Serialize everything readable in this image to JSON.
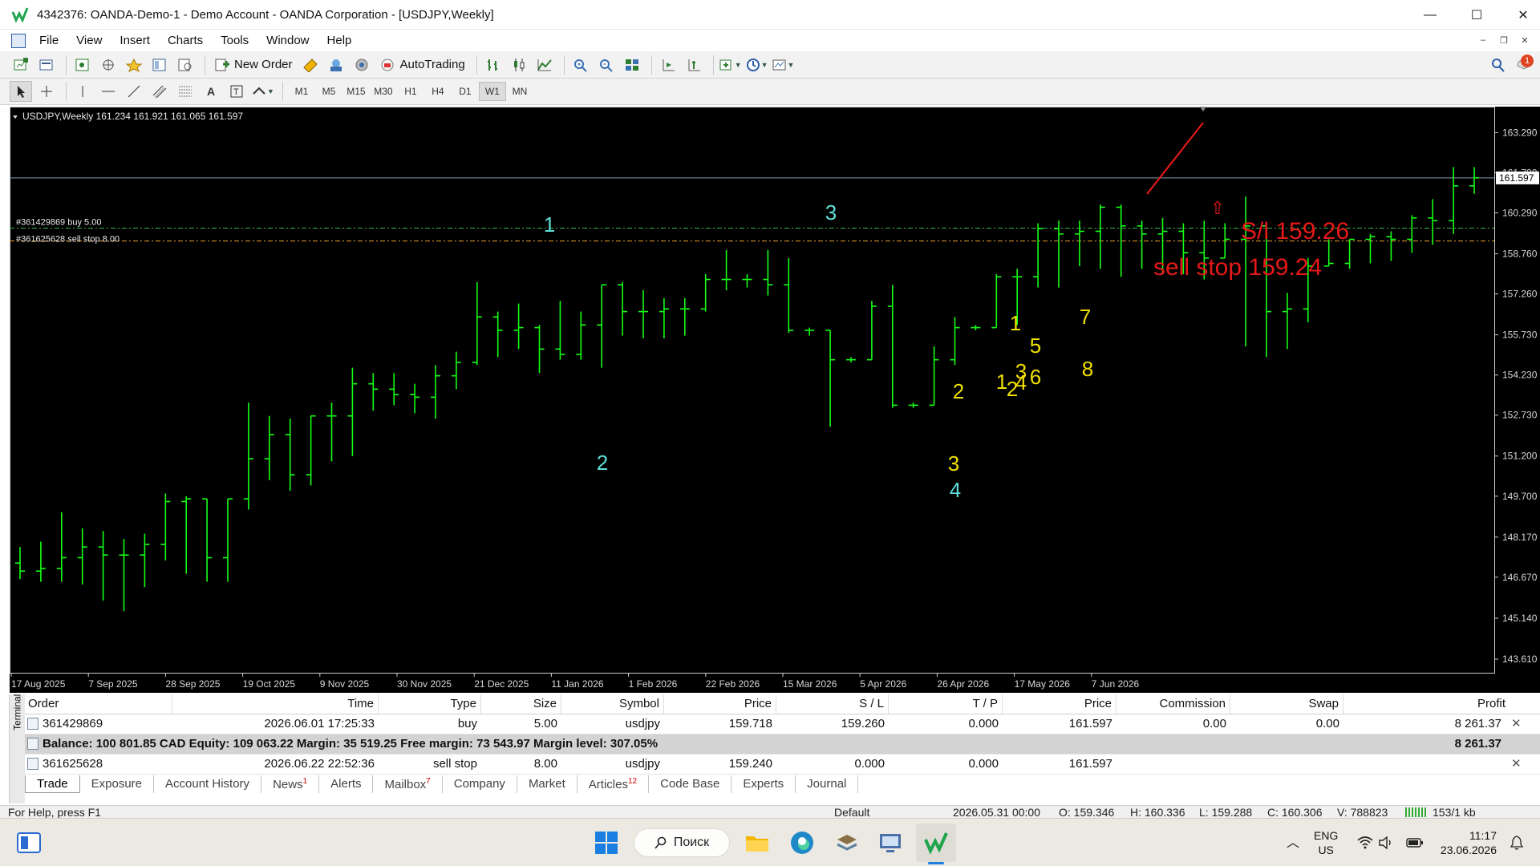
{
  "window": {
    "title": "4342376: OANDA-Demo-1 - Demo Account - OANDA Corporation - [USDJPY,Weekly]",
    "minimize": "—",
    "maximize": "☐",
    "close": "✕"
  },
  "menu": [
    "File",
    "View",
    "Insert",
    "Charts",
    "Tools",
    "Window",
    "Help"
  ],
  "toolbar": {
    "new_order": "New Order",
    "autotrading": "AutoTrading",
    "timeframes": [
      "M1",
      "M5",
      "M15",
      "M30",
      "H1",
      "H4",
      "D1",
      "W1",
      "MN"
    ],
    "active_timeframe": "W1",
    "notification_count": "1"
  },
  "chart": {
    "header": "USDJPY,Weekly  161.234 161.921 161.065 161.597",
    "current_price_label": "161.597",
    "order_line_buy": "#361429869 buy 5.00",
    "order_line_sell": "#361625628 sell stop 8.00",
    "annotation_sl": "S/l 159.26",
    "annotation_sell_stop": "sell stop 159.24",
    "arrow_up": "⇧"
  },
  "chart_data": {
    "type": "ohlc",
    "symbol": "USDJPY",
    "timeframe": "Weekly",
    "ylim": [
      143.1,
      164.2
    ],
    "y_ticks": [
      "163.290",
      "161.790",
      "160.290",
      "158.760",
      "157.260",
      "155.730",
      "154.230",
      "152.730",
      "151.200",
      "149.700",
      "148.170",
      "146.670",
      "145.140",
      "143.610"
    ],
    "x_ticks": [
      "17 Aug 2025",
      "7 Sep 2025",
      "28 Sep 2025",
      "19 Oct 2025",
      "9 Nov 2025",
      "30 Nov 2025",
      "21 Dec 2025",
      "11 Jan 2026",
      "1 Feb 2026",
      "22 Feb 2026",
      "15 Mar 2026",
      "5 Apr 2026",
      "26 Apr 2026",
      "17 May 2026",
      "7 Jun 2026"
    ],
    "last_price": 161.597,
    "buy_order_price": 159.718,
    "sell_stop_price": 159.24,
    "bars": [
      [
        147.2,
        147.8,
        146.6,
        146.9
      ],
      [
        146.9,
        148.0,
        146.5,
        147.0
      ],
      [
        147.0,
        149.1,
        146.5,
        147.4
      ],
      [
        147.4,
        148.5,
        146.4,
        147.8
      ],
      [
        147.8,
        148.4,
        145.8,
        147.5
      ],
      [
        147.5,
        148.1,
        145.4,
        147.5
      ],
      [
        147.5,
        148.3,
        146.3,
        147.9
      ],
      [
        147.9,
        149.8,
        147.3,
        149.5
      ],
      [
        149.5,
        149.7,
        146.8,
        149.6
      ],
      [
        149.6,
        149.6,
        146.5,
        147.4
      ],
      [
        147.4,
        149.6,
        146.5,
        149.6
      ],
      [
        149.6,
        153.2,
        149.2,
        151.1
      ],
      [
        151.1,
        152.7,
        150.3,
        152.0
      ],
      [
        152.0,
        152.6,
        149.9,
        150.5
      ],
      [
        150.5,
        152.7,
        150.1,
        152.7
      ],
      [
        152.7,
        153.2,
        151.0,
        152.7
      ],
      [
        152.7,
        154.5,
        151.2,
        153.9
      ],
      [
        153.9,
        154.3,
        152.9,
        153.7
      ],
      [
        153.7,
        154.3,
        153.1,
        153.5
      ],
      [
        153.5,
        153.9,
        152.8,
        153.4
      ],
      [
        153.4,
        154.6,
        152.6,
        154.2
      ],
      [
        154.2,
        155.1,
        153.7,
        154.7
      ],
      [
        154.7,
        157.7,
        154.6,
        156.4
      ],
      [
        156.4,
        156.6,
        154.9,
        155.9
      ],
      [
        155.9,
        156.9,
        155.2,
        156.0
      ],
      [
        156.0,
        156.1,
        154.3,
        155.2
      ],
      [
        155.2,
        157.0,
        154.8,
        155.0
      ],
      [
        155.0,
        156.6,
        154.8,
        156.1
      ],
      [
        156.1,
        157.6,
        154.5,
        157.6
      ],
      [
        157.6,
        157.7,
        155.7,
        156.6
      ],
      [
        156.6,
        157.4,
        155.6,
        156.6
      ],
      [
        156.6,
        157.1,
        155.6,
        156.7
      ],
      [
        156.7,
        157.1,
        155.7,
        156.7
      ],
      [
        156.7,
        158.0,
        156.6,
        157.8
      ],
      [
        157.8,
        158.9,
        157.4,
        157.8
      ],
      [
        157.8,
        158.0,
        157.5,
        157.8
      ],
      [
        157.8,
        158.9,
        157.2,
        157.6
      ],
      [
        157.6,
        158.6,
        155.8,
        155.9
      ],
      [
        155.9,
        156.0,
        155.7,
        155.9
      ],
      [
        155.9,
        155.9,
        152.3,
        154.8
      ],
      [
        154.8,
        154.9,
        154.7,
        154.8
      ],
      [
        154.8,
        157.0,
        154.8,
        156.8
      ],
      [
        156.8,
        157.6,
        153.0,
        153.1
      ],
      [
        153.1,
        153.2,
        153.0,
        153.1
      ],
      [
        153.1,
        155.3,
        153.1,
        154.8
      ],
      [
        154.8,
        156.4,
        154.6,
        156.0
      ],
      [
        156.0,
        156.1,
        155.9,
        156.0
      ],
      [
        156.0,
        158.0,
        156.0,
        157.9
      ],
      [
        157.9,
        158.2,
        156.1,
        157.9
      ],
      [
        157.9,
        159.9,
        157.5,
        159.7
      ],
      [
        159.7,
        160.0,
        157.5,
        159.5
      ],
      [
        159.5,
        160.0,
        158.3,
        159.6
      ],
      [
        159.6,
        160.6,
        158.2,
        160.5
      ],
      [
        160.5,
        160.6,
        157.9,
        159.8
      ],
      [
        159.8,
        160.0,
        158.2,
        159.5
      ],
      [
        159.5,
        160.1,
        158.0,
        159.6
      ],
      [
        159.6,
        159.9,
        158.0,
        158.8
      ],
      [
        158.8,
        160.0,
        157.8,
        158.6
      ],
      [
        158.6,
        159.9,
        158.8,
        159.3
      ],
      [
        159.3,
        160.9,
        155.3,
        159.8
      ],
      [
        159.8,
        157.3,
        154.9,
        156.6
      ],
      [
        156.6,
        157.3,
        155.2,
        156.7
      ],
      [
        156.7,
        158.6,
        156.2,
        158.3
      ],
      [
        158.3,
        159.3,
        158.5,
        158.4
      ],
      [
        158.4,
        159.2,
        158.2,
        159.3
      ],
      [
        159.3,
        159.5,
        158.4,
        159.4
      ],
      [
        159.4,
        159.6,
        158.5,
        159.3
      ],
      [
        159.3,
        160.2,
        158.8,
        160.1
      ],
      [
        160.1,
        160.8,
        159.1,
        160.0
      ],
      [
        160.0,
        162.0,
        159.5,
        161.3
      ],
      [
        161.3,
        162.0,
        161.0,
        161.6
      ]
    ]
  },
  "annotations": [
    {
      "text": "1",
      "color": "#5fe0d8"
    },
    {
      "text": "2",
      "color": "#5fe0d8"
    },
    {
      "text": "3",
      "color": "#5fe0d8"
    },
    {
      "text": "1",
      "color": "#f0e000"
    },
    {
      "text": "2",
      "color": "#f0e000"
    },
    {
      "text": "3",
      "color": "#f0e000"
    },
    {
      "text": "4",
      "color": "#5fe0d8"
    },
    {
      "text": "1",
      "color": "#f0e000"
    },
    {
      "text": "2",
      "color": "#f0e000"
    },
    {
      "text": "3",
      "color": "#f0e000"
    },
    {
      "text": "4",
      "color": "#f0e000"
    },
    {
      "text": "5",
      "color": "#f0e000"
    },
    {
      "text": "6",
      "color": "#f0e000"
    },
    {
      "text": "7",
      "color": "#f0e000"
    },
    {
      "text": "8",
      "color": "#f0e000"
    }
  ],
  "terminal": {
    "side_label": "Terminal",
    "columns": [
      "Order",
      "Time",
      "Type",
      "Size",
      "Symbol",
      "Price",
      "S / L",
      "T / P",
      "Price",
      "Commission",
      "Swap",
      "Profit"
    ],
    "rows": [
      {
        "order": "361429869",
        "time": "2026.06.01 17:25:33",
        "type": "buy",
        "size": "5.00",
        "symbol": "usdjpy",
        "price": "159.718",
        "sl": "159.260",
        "tp": "0.000",
        "cur": "161.597",
        "commission": "0.00",
        "swap": "0.00",
        "profit": "8 261.37"
      },
      {
        "order": "361625628",
        "time": "2026.06.22 22:52:36",
        "type": "sell stop",
        "size": "8.00",
        "symbol": "usdjpy",
        "price": "159.240",
        "sl": "0.000",
        "tp": "0.000",
        "cur": "161.597",
        "commission": "",
        "swap": "",
        "profit": ""
      }
    ],
    "balance_line": "Balance: 100 801.85 CAD  Equity: 109 063.22  Margin: 35 519.25  Free margin: 73 543.97  Margin level: 307.05%",
    "balance_profit": "8 261.37",
    "tabs": [
      {
        "label": "Trade",
        "badge": ""
      },
      {
        "label": "Exposure",
        "badge": ""
      },
      {
        "label": "Account History",
        "badge": ""
      },
      {
        "label": "News",
        "badge": "1"
      },
      {
        "label": "Alerts",
        "badge": ""
      },
      {
        "label": "Mailbox",
        "badge": "7"
      },
      {
        "label": "Company",
        "badge": ""
      },
      {
        "label": "Market",
        "badge": ""
      },
      {
        "label": "Articles",
        "badge": "12"
      },
      {
        "label": "Code Base",
        "badge": ""
      },
      {
        "label": "Experts",
        "badge": ""
      },
      {
        "label": "Journal",
        "badge": ""
      }
    ]
  },
  "status": {
    "help": "For Help, press F1",
    "profile": "Default",
    "datetime": "2026.05.31 00:00",
    "open": "O: 159.346",
    "high": "H: 160.336",
    "low": "L: 159.288",
    "close": "C: 160.306",
    "volume": "V: 788823",
    "traffic": "153/1 kb"
  },
  "taskbar": {
    "search": "Поиск",
    "lang_top": "ENG",
    "lang_bottom": "US",
    "time": "11:17",
    "date": "23.06.2026"
  }
}
